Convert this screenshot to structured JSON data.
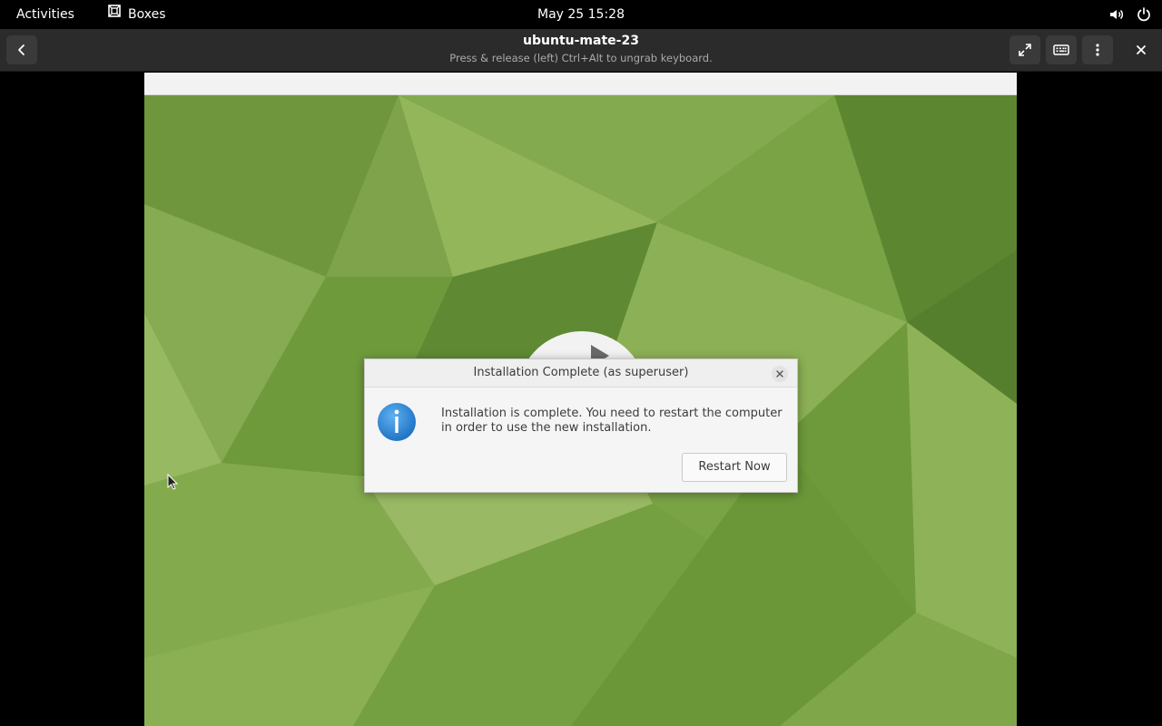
{
  "topbar": {
    "activities": "Activities",
    "app_name": "Boxes",
    "clock": "May 25  15:28",
    "icons": [
      "boxes-app-icon",
      "volume-icon",
      "power-icon"
    ]
  },
  "headerbar": {
    "title": "ubuntu-mate-23",
    "subtitle": "Press & release (left) Ctrl+Alt to ungrab keyboard.",
    "buttons": [
      "back-icon",
      "fullscreen-icon",
      "keyboard-icon",
      "kebab-menu-icon",
      "close-icon"
    ]
  },
  "dialog": {
    "title": "Installation Complete (as superuser)",
    "message": "Installation is complete. You need to restart the computer in order to use the new installation.",
    "button": "Restart Now",
    "icon": "info-icon"
  },
  "colors": {
    "topbar": "#000000",
    "headerbar": "#2b2b2b",
    "wallpaper_green": "#7aa046",
    "info_blue": "#2f8ad6"
  }
}
